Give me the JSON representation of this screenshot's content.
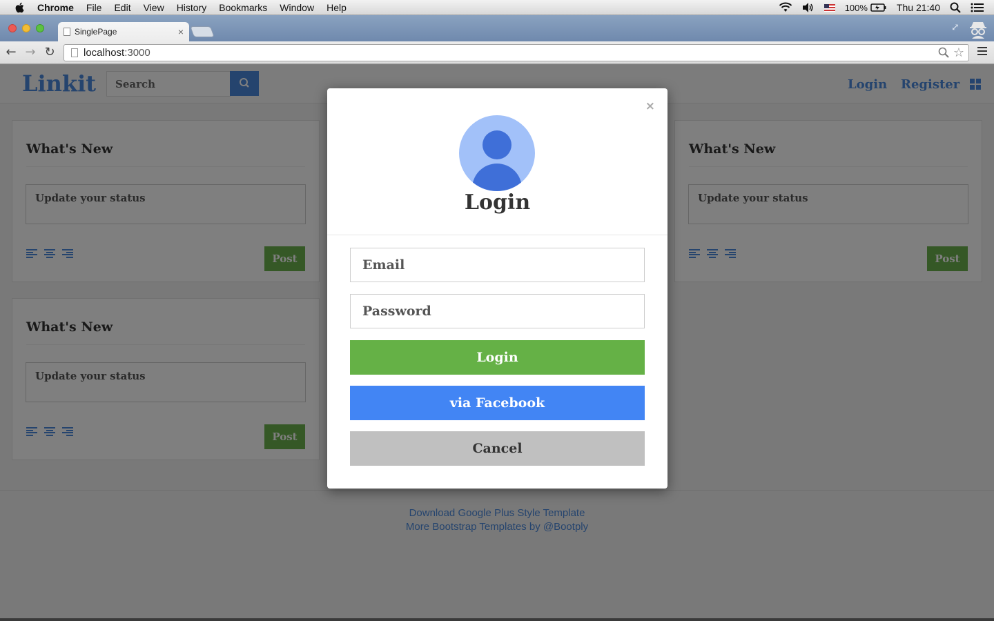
{
  "menubar": {
    "app": "Chrome",
    "items": [
      "File",
      "Edit",
      "View",
      "History",
      "Bookmarks",
      "Window",
      "Help"
    ],
    "battery": "100%",
    "clock": "Thu 21:40"
  },
  "browser": {
    "tab_title": "SinglePage",
    "tab_close": "×",
    "url_host": "localhost",
    "url_port": ":3000"
  },
  "site": {
    "brand": "Linkit",
    "search_placeholder": "Search",
    "nav": {
      "login": "Login",
      "register": "Register"
    },
    "cards": [
      {
        "title": "What's New",
        "status_placeholder": "Update your status",
        "post": "Post"
      },
      {
        "title": "What's New",
        "status_placeholder": "Update your status",
        "post": "Post"
      },
      {
        "title": "What's New",
        "status_placeholder": "Update your status",
        "post": "Post"
      }
    ],
    "footer": {
      "link1": "Download Google Plus Style Template",
      "link2": "More Bootstrap Templates by @Bootply"
    }
  },
  "modal": {
    "close": "×",
    "title": "Login",
    "email_placeholder": "Email",
    "password_placeholder": "Password",
    "login_button": "Login",
    "facebook_button": "via Facebook",
    "cancel_button": "Cancel"
  },
  "colors": {
    "brand_blue": "#4a89dc",
    "login_green": "#65b146",
    "facebook_blue": "#4285f4",
    "cancel_gray": "#c0c0c0"
  }
}
